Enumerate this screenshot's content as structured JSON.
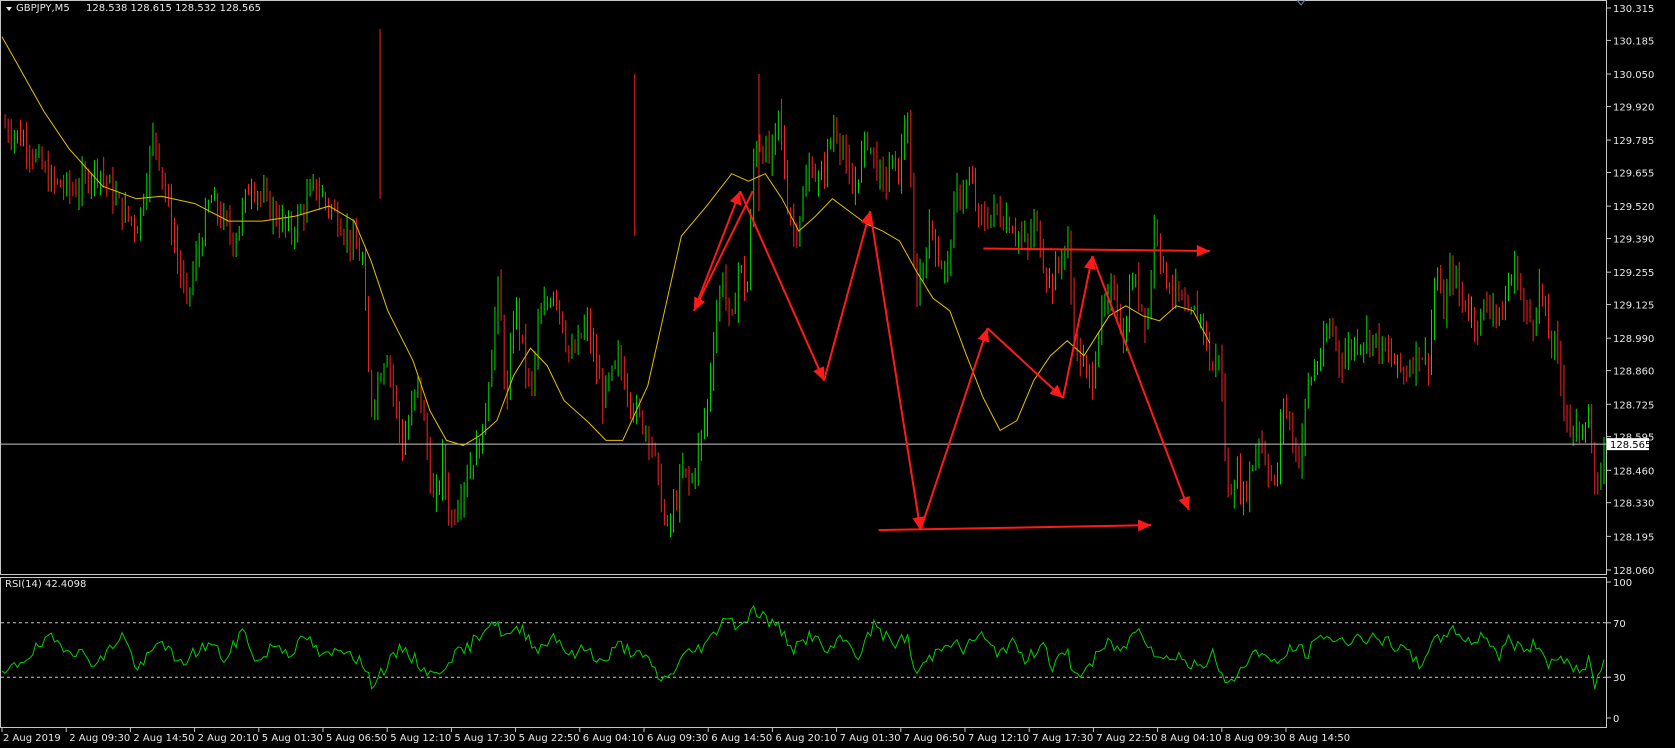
{
  "colors": {
    "background": "#000000",
    "frame": "#c8c8c8",
    "bull": "#00e000",
    "bear": "#ff2020",
    "ma": "#e6c000",
    "arrow": "#ff1a1a",
    "rsi": "#00d000",
    "level": "#c8c8c8",
    "text": "#e6e6e6"
  },
  "header": {
    "symbol_label": "GBPJPY,M5",
    "ohlc": "128.538 128.615 128.532 128.565",
    "menu_icon": "triangle-down-icon"
  },
  "rsi_panel": {
    "label": "RSI(14) 42.4098"
  },
  "chart_data": [
    {
      "type": "candlestick",
      "name": "price",
      "price_axis": {
        "ylim": [
          128.06,
          130.315
        ],
        "ticks": [
          "130.315",
          "130.185",
          "130.050",
          "129.920",
          "129.785",
          "129.655",
          "129.520",
          "129.390",
          "129.255",
          "129.125",
          "128.990",
          "128.860",
          "128.725",
          "128.595",
          "128.460",
          "128.330",
          "128.195",
          "128.060"
        ]
      },
      "current_price": "128.565",
      "time_axis": {
        "ticks": [
          "2 Aug 2019",
          "2 Aug 09:30",
          "2 Aug 14:50",
          "2 Aug 20:10",
          "5 Aug 01:30",
          "5 Aug 06:50",
          "5 Aug 12:10",
          "5 Aug 17:30",
          "5 Aug 22:50",
          "6 Aug 04:10",
          "6 Aug 09:30",
          "6 Aug 14:50",
          "6 Aug 20:10",
          "7 Aug 01:30",
          "7 Aug 06:50",
          "7 Aug 12:10",
          "7 Aug 17:30",
          "7 Aug 22:50",
          "8 Aug 04:10",
          "8 Aug 09:30",
          "8 Aug 14:50"
        ]
      },
      "close_path": [
        [
          0,
          129.85
        ],
        [
          3,
          129.78
        ],
        [
          6,
          129.62
        ],
        [
          9,
          129.58
        ],
        [
          12,
          129.68
        ],
        [
          15,
          129.5
        ],
        [
          17,
          129.44
        ],
        [
          19,
          129.82
        ],
        [
          21,
          129.47
        ],
        [
          23,
          129.13
        ],
        [
          26,
          129.55
        ],
        [
          29,
          129.38
        ],
        [
          31,
          129.62
        ],
        [
          33,
          129.53
        ],
        [
          36,
          129.41
        ],
        [
          39,
          129.6
        ],
        [
          42,
          129.47
        ],
        [
          45,
          129.3
        ],
        [
          46,
          128.7
        ],
        [
          48,
          128.95
        ],
        [
          50,
          128.55
        ],
        [
          52,
          128.82
        ],
        [
          54,
          128.3
        ],
        [
          55,
          128.5
        ],
        [
          56,
          128.25
        ],
        [
          58,
          128.45
        ],
        [
          60,
          128.6
        ],
        [
          62,
          129.2
        ],
        [
          63,
          128.7
        ],
        [
          64,
          129.15
        ],
        [
          66,
          128.75
        ],
        [
          67,
          129.05
        ],
        [
          69,
          129.2
        ],
        [
          71,
          128.9
        ],
        [
          73,
          129.05
        ],
        [
          75,
          128.75
        ],
        [
          77,
          128.9
        ],
        [
          79,
          128.7
        ],
        [
          81,
          128.6
        ],
        [
          82,
          128.4
        ],
        [
          83,
          128.2
        ],
        [
          85,
          128.45
        ],
        [
          86,
          128.4
        ],
        [
          88,
          128.7
        ],
        [
          89,
          129.05
        ],
        [
          90,
          129.25
        ],
        [
          91,
          129.0
        ],
        [
          92,
          129.3
        ],
        [
          93,
          129.15
        ],
        [
          94,
          129.8
        ],
        [
          96,
          129.7
        ],
        [
          97,
          129.9
        ],
        [
          98,
          129.55
        ],
        [
          99,
          129.4
        ],
        [
          101,
          129.7
        ],
        [
          102,
          129.6
        ],
        [
          104,
          129.85
        ],
        [
          105,
          129.75
        ],
        [
          106,
          129.55
        ],
        [
          108,
          129.8
        ],
        [
          110,
          129.6
        ],
        [
          111,
          129.7
        ],
        [
          112,
          129.65
        ],
        [
          113,
          129.92
        ],
        [
          114,
          129.15
        ],
        [
          115,
          129.3
        ],
        [
          116,
          129.45
        ],
        [
          117,
          129.3
        ],
        [
          118,
          129.25
        ],
        [
          119,
          129.55
        ],
        [
          121,
          129.62
        ],
        [
          122,
          129.45
        ],
        [
          124,
          129.5
        ],
        [
          126,
          129.45
        ],
        [
          128,
          129.35
        ],
        [
          129,
          129.47
        ],
        [
          130,
          129.3
        ],
        [
          131,
          129.2
        ],
        [
          132,
          129.3
        ],
        [
          133,
          129.38
        ],
        [
          134,
          128.95
        ],
        [
          136,
          128.8
        ],
        [
          137,
          129.05
        ],
        [
          139,
          129.2
        ],
        [
          140,
          128.95
        ],
        [
          141,
          129.25
        ],
        [
          143,
          129.05
        ],
        [
          144,
          129.5
        ],
        [
          145,
          129.25
        ],
        [
          147,
          129.15
        ],
        [
          148,
          129.05
        ],
        [
          149,
          129.1
        ],
        [
          150,
          129.05
        ],
        [
          151,
          128.85
        ],
        [
          152,
          128.95
        ],
        [
          153,
          128.35
        ],
        [
          154,
          128.45
        ],
        [
          155,
          128.35
        ],
        [
          157,
          128.6
        ],
        [
          158,
          128.48
        ],
        [
          159,
          128.38
        ],
        [
          160,
          128.75
        ],
        [
          161,
          128.6
        ],
        [
          162,
          128.5
        ],
        [
          163,
          128.8
        ],
        [
          165,
          128.95
        ],
        [
          166,
          129.05
        ],
        [
          167,
          128.9
        ],
        [
          169,
          128.98
        ],
        [
          171,
          129.0
        ],
        [
          173,
          128.92
        ],
        [
          175,
          128.85
        ],
        [
          177,
          128.95
        ],
        [
          178,
          128.88
        ],
        [
          179,
          129.25
        ],
        [
          180,
          129.1
        ],
        [
          181,
          129.28
        ],
        [
          182,
          129.15
        ],
        [
          183,
          129.12
        ],
        [
          184,
          129.05
        ],
        [
          185,
          129.1
        ],
        [
          186,
          129.15
        ],
        [
          187,
          129.05
        ],
        [
          188,
          129.2
        ],
        [
          189,
          129.28
        ],
        [
          190,
          129.1
        ],
        [
          191,
          129.05
        ],
        [
          192,
          129.2
        ],
        [
          193,
          129.0
        ],
        [
          194,
          128.95
        ],
        [
          195,
          128.75
        ],
        [
          196,
          128.6
        ],
        [
          197,
          128.62
        ],
        [
          198,
          128.7
        ],
        [
          199,
          128.32
        ],
        [
          200,
          128.55
        ]
      ],
      "moving_average": [
        [
          0,
          130.2
        ],
        [
          5,
          129.9
        ],
        [
          8,
          129.75
        ],
        [
          12,
          129.6
        ],
        [
          16,
          129.55
        ],
        [
          19,
          129.56
        ],
        [
          23,
          129.53
        ],
        [
          27,
          129.46
        ],
        [
          31,
          129.46
        ],
        [
          35,
          129.48
        ],
        [
          39,
          129.52
        ],
        [
          42,
          129.46
        ],
        [
          44,
          129.3
        ],
        [
          46,
          129.1
        ],
        [
          49,
          128.9
        ],
        [
          51,
          128.7
        ],
        [
          53,
          128.58
        ],
        [
          55,
          128.56
        ],
        [
          57,
          128.6
        ],
        [
          59,
          128.66
        ],
        [
          61,
          128.84
        ],
        [
          63,
          128.95
        ],
        [
          65,
          128.88
        ],
        [
          67,
          128.74
        ],
        [
          70,
          128.65
        ],
        [
          72,
          128.58
        ],
        [
          74,
          128.58
        ],
        [
          77,
          128.8
        ],
        [
          79,
          129.1
        ],
        [
          81,
          129.4
        ],
        [
          84,
          129.52
        ],
        [
          87,
          129.65
        ],
        [
          89,
          129.62
        ],
        [
          91,
          129.65
        ],
        [
          93,
          129.55
        ],
        [
          95,
          129.42
        ],
        [
          97,
          129.48
        ],
        [
          99,
          129.55
        ],
        [
          101,
          129.5
        ],
        [
          103,
          129.45
        ],
        [
          105,
          129.42
        ],
        [
          107,
          129.38
        ],
        [
          109,
          129.26
        ],
        [
          111,
          129.15
        ],
        [
          113,
          129.1
        ],
        [
          115,
          128.92
        ],
        [
          117,
          128.75
        ],
        [
          119,
          128.62
        ],
        [
          121,
          128.66
        ],
        [
          123,
          128.82
        ],
        [
          125,
          128.92
        ],
        [
          127,
          128.98
        ],
        [
          129,
          128.92
        ],
        [
          132,
          129.08
        ],
        [
          134,
          129.12
        ],
        [
          136,
          129.08
        ],
        [
          138,
          129.06
        ],
        [
          140,
          129.12
        ],
        [
          142,
          129.1
        ],
        [
          144,
          128.97
        ]
      ],
      "ma_x_scale": "200",
      "arrows": [
        [
          [
            89.5,
            129.58
          ],
          [
            82.5,
            129.1
          ]
        ],
        [
          [
            82.5,
            129.1
          ],
          [
            88.0,
            129.58
          ]
        ],
        [
          [
            88.0,
            129.58
          ],
          [
            98.0,
            128.82
          ]
        ],
        [
          [
            98.0,
            128.82
          ],
          [
            103.5,
            129.5
          ]
        ],
        [
          [
            103.5,
            129.5
          ],
          [
            109.5,
            128.22
          ]
        ],
        [
          [
            109.5,
            128.22
          ],
          [
            117.5,
            129.03
          ]
        ],
        [
          [
            117.5,
            129.03
          ],
          [
            126.5,
            128.75
          ]
        ],
        [
          [
            126.5,
            128.75
          ],
          [
            130.0,
            129.32
          ]
        ],
        [
          [
            130.0,
            129.32
          ],
          [
            141.5,
            128.3
          ]
        ],
        [
          [
            117.0,
            129.35
          ],
          [
            144.0,
            129.34
          ]
        ],
        [
          [
            104.5,
            128.22
          ],
          [
            137.0,
            128.24
          ]
        ]
      ]
    },
    {
      "type": "line",
      "name": "RSI(14)",
      "ylim": [
        0,
        100
      ],
      "ticks": [
        "100",
        "70",
        "30",
        "0"
      ],
      "levels": [
        70,
        30
      ],
      "values_path": [
        [
          0,
          30
        ],
        [
          3,
          45
        ],
        [
          6,
          58
        ],
        [
          9,
          50
        ],
        [
          12,
          40
        ],
        [
          15,
          62
        ],
        [
          17,
          35
        ],
        [
          20,
          58
        ],
        [
          22,
          38
        ],
        [
          24,
          48
        ],
        [
          26,
          55
        ],
        [
          28,
          42
        ],
        [
          30,
          65
        ],
        [
          32,
          40
        ],
        [
          34,
          55
        ],
        [
          36,
          48
        ],
        [
          38,
          60
        ],
        [
          40,
          44
        ],
        [
          43,
          52
        ],
        [
          45,
          40
        ],
        [
          46,
          25
        ],
        [
          48,
          38
        ],
        [
          50,
          52
        ],
        [
          52,
          40
        ],
        [
          54,
          30
        ],
        [
          56,
          45
        ],
        [
          58,
          50
        ],
        [
          61,
          72
        ],
        [
          63,
          60
        ],
        [
          65,
          65
        ],
        [
          67,
          50
        ],
        [
          69,
          62
        ],
        [
          71,
          45
        ],
        [
          73,
          52
        ],
        [
          75,
          40
        ],
        [
          77,
          54
        ],
        [
          79,
          48
        ],
        [
          81,
          40
        ],
        [
          82,
          30
        ],
        [
          83,
          28
        ],
        [
          85,
          45
        ],
        [
          88,
          55
        ],
        [
          89,
          62
        ],
        [
          90,
          75
        ],
        [
          92,
          68
        ],
        [
          94,
          80
        ],
        [
          96,
          70
        ],
        [
          97,
          66
        ],
        [
          99,
          50
        ],
        [
          101,
          62
        ],
        [
          103,
          48
        ],
        [
          105,
          58
        ],
        [
          107,
          46
        ],
        [
          109,
          70
        ],
        [
          111,
          54
        ],
        [
          113,
          60
        ],
        [
          114,
          32
        ],
        [
          116,
          45
        ],
        [
          118,
          58
        ],
        [
          120,
          50
        ],
        [
          122,
          62
        ],
        [
          124,
          48
        ],
        [
          126,
          55
        ],
        [
          128,
          42
        ],
        [
          130,
          58
        ],
        [
          131,
          38
        ],
        [
          133,
          48
        ],
        [
          134,
          30
        ],
        [
          136,
          40
        ],
        [
          138,
          55
        ],
        [
          140,
          50
        ],
        [
          142,
          70
        ],
        [
          143,
          55
        ],
        [
          145,
          42
        ],
        [
          147,
          48
        ],
        [
          148,
          38
        ],
        [
          150,
          40
        ],
        [
          151,
          48
        ],
        [
          153,
          22
        ],
        [
          155,
          40
        ],
        [
          157,
          50
        ],
        [
          159,
          38
        ],
        [
          161,
          52
        ],
        [
          163,
          48
        ],
        [
          165,
          62
        ],
        [
          167,
          55
        ],
        [
          169,
          60
        ],
        [
          171,
          58
        ],
        [
          173,
          55
        ],
        [
          175,
          50
        ],
        [
          177,
          38
        ],
        [
          178,
          52
        ],
        [
          180,
          60
        ],
        [
          181,
          68
        ],
        [
          183,
          55
        ],
        [
          185,
          62
        ],
        [
          187,
          45
        ],
        [
          188,
          58
        ],
        [
          190,
          50
        ],
        [
          192,
          55
        ],
        [
          193,
          40
        ],
        [
          195,
          45
        ],
        [
          196,
          38
        ],
        [
          197,
          30
        ],
        [
          198,
          45
        ],
        [
          199,
          22
        ],
        [
          200,
          42
        ]
      ]
    }
  ]
}
